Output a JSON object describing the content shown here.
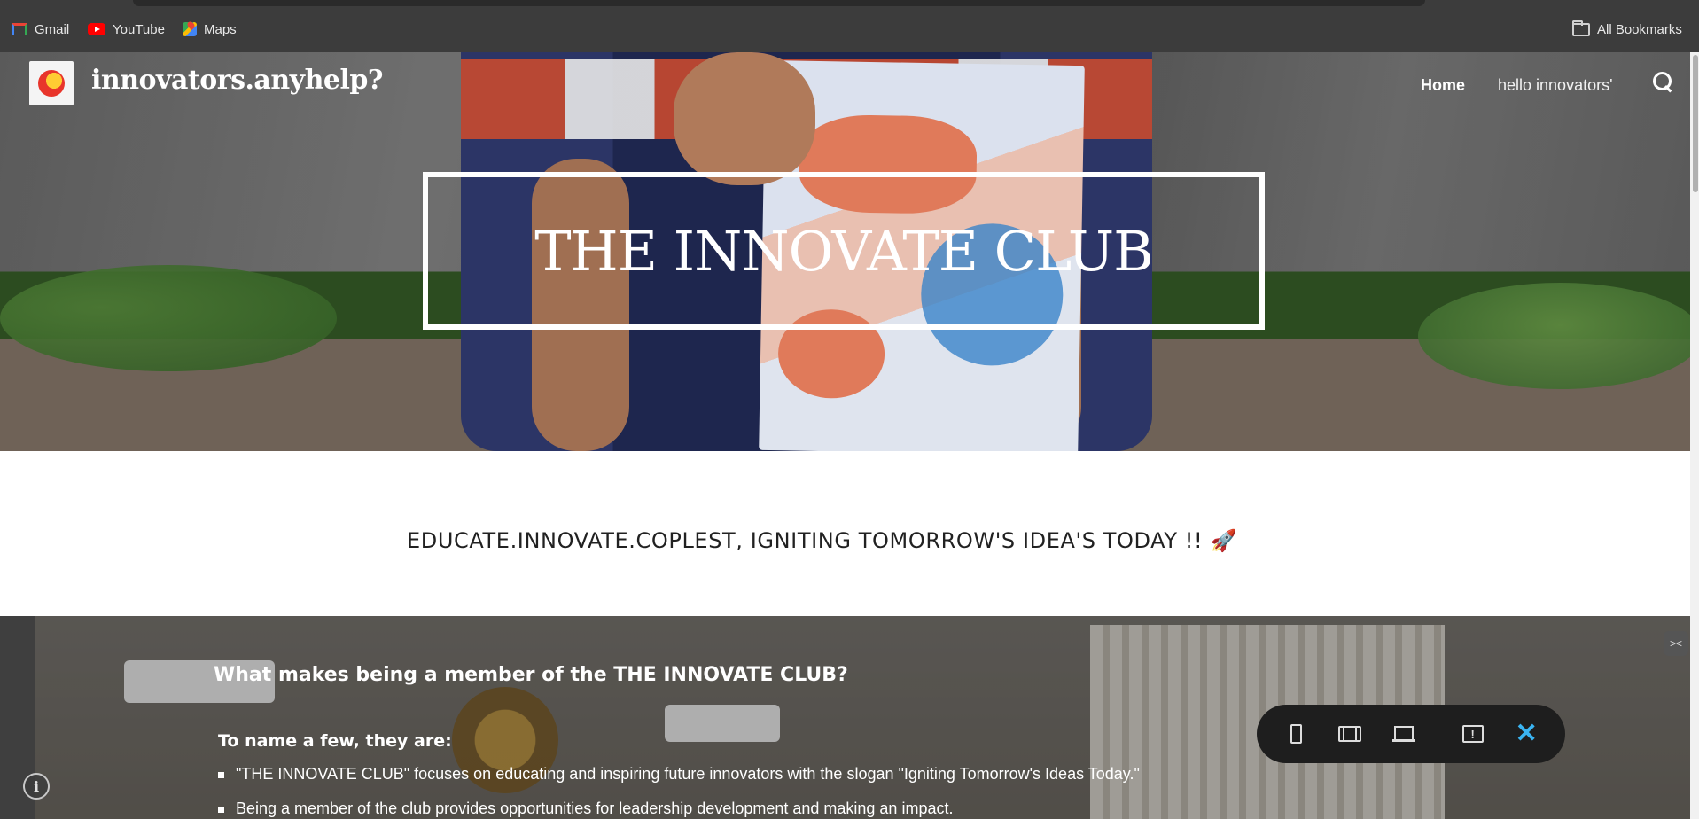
{
  "browser": {
    "bookmarks": [
      {
        "label": "Gmail",
        "icon": "gmail-icon"
      },
      {
        "label": "YouTube",
        "icon": "youtube-icon"
      },
      {
        "label": "Maps",
        "icon": "maps-icon"
      }
    ],
    "all_bookmarks": "All Bookmarks"
  },
  "site": {
    "title": "innovators.anyhelp?",
    "logo_icon": "site-logo-icon",
    "nav": {
      "home": "Home",
      "hello": "hello innovators'",
      "search_icon": "search-icon"
    }
  },
  "hero": {
    "title": "THE INNOVATE CLUB"
  },
  "tagline": {
    "text": "EDUCATE.INNOVATE.COPLEST, IGNITING TOMORROW'S IDEA'S TODAY !! 🚀"
  },
  "member_section": {
    "heading": "What makes being a member of the THE INNOVATE CLUB?",
    "subheading": "To name a few, they are:",
    "bullets": [
      "\"THE INNOVATE CLUB\" focuses on educating and inspiring future innovators with the slogan \"Igniting Tomorrow's Ideas Today.\"",
      "Being a member of the club provides opportunities for leadership development and making an impact."
    ]
  },
  "preview_toolbar": {
    "buttons": [
      "phone-preview-icon",
      "tablet-preview-icon",
      "laptop-preview-icon",
      "feedback-icon",
      "close-icon"
    ],
    "close_glyph": "✕",
    "feedback_glyph": "!"
  },
  "info_glyph": "i",
  "colors": {
    "close_accent": "#3ab4f2",
    "toolbar_bg": "#1e1e1e",
    "bookmarks_bg": "#3c3c3c"
  }
}
